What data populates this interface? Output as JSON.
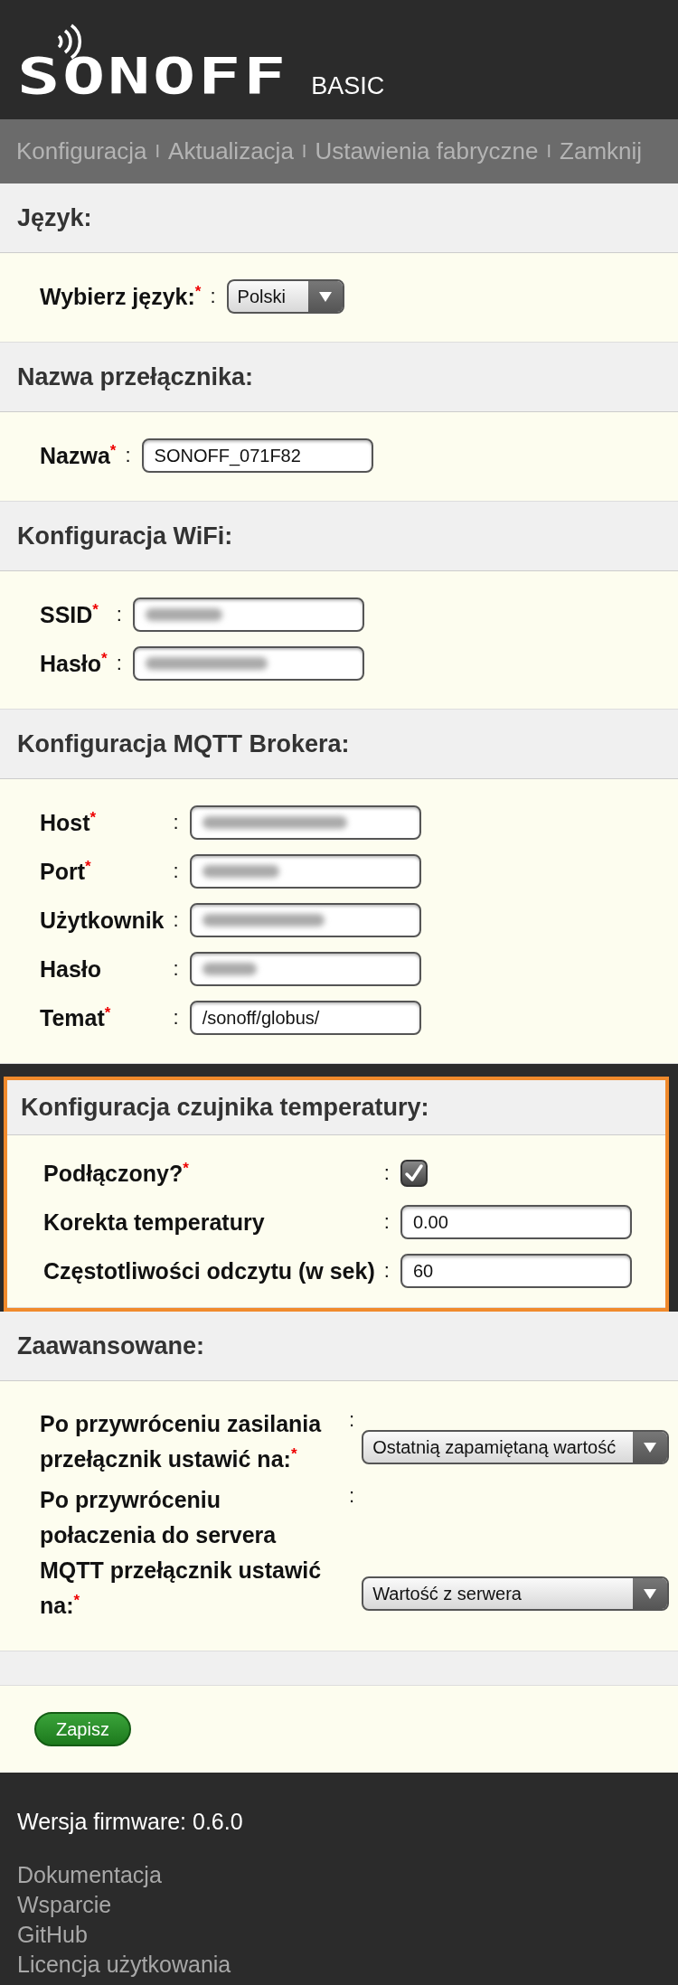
{
  "header": {
    "logo": "SONOFF",
    "model": "BASIC"
  },
  "nav": [
    {
      "label": "Konfiguracja",
      "separator": "I"
    },
    {
      "label": "Aktualizacja",
      "separator": "I"
    },
    {
      "label": "Ustawienia fabryczne",
      "separator": "I"
    },
    {
      "label": "Zamknij"
    }
  ],
  "sections": [
    {
      "title": "Język:",
      "highlighted": false,
      "label_wrap": false,
      "fields": [
        {
          "kind": "select",
          "label": "Wybierz język:$^{*}$",
          "colon": ":",
          "value": "Polski"
        }
      ]
    },
    {
      "title": "Nazwa przełącznika:",
      "highlighted": false,
      "label_wrap": false,
      "fields": [
        {
          "kind": "text",
          "label": "Nazwa$^{*}$",
          "colon": ":",
          "value": "SONOFF_071F82"
        }
      ]
    },
    {
      "title": "Konfiguracja WiFi:",
      "highlighted": false,
      "label_wrap": false,
      "fields": [
        {
          "kind": "text",
          "label": "SSID$^{*}$",
          "colon": ":",
          "blurred": true
        },
        {
          "kind": "text",
          "label": "Hasło$^{*}$",
          "colon": ":",
          "blurred": true
        }
      ]
    },
    {
      "title": "Konfiguracja MQTT Brokera:",
      "highlighted": false,
      "label_wrap": false,
      "fields": [
        {
          "kind": "text",
          "label": "Host$^{*}$",
          "colon": ":",
          "blurred": true
        },
        {
          "kind": "text",
          "label": "Port$^{*}$",
          "colon": ":",
          "blurred": true
        },
        {
          "kind": "text",
          "label": "Użytkownik",
          "colon": ":",
          "blurred": true
        },
        {
          "kind": "text",
          "label": "Hasło",
          "colon": ":",
          "blurred": true
        },
        {
          "kind": "text",
          "label": "Temat$^{*}$",
          "colon": ":",
          "value": "/sonoff/globus/"
        }
      ]
    },
    {
      "title": "Konfiguracja czujnika temperatury:",
      "highlighted": true,
      "label_wrap": false,
      "fields": [
        {
          "kind": "checkbox",
          "label": "Podłączony?$^{*}$",
          "colon": ":",
          "checked": true
        },
        {
          "kind": "text",
          "label": "Korekta temperatury",
          "colon": ":",
          "value": "0.00"
        },
        {
          "kind": "text",
          "label": "Częstotliwości odczytu (w sek)",
          "colon": ":",
          "value": "60"
        }
      ]
    },
    {
      "title": "Zaawansowane:",
      "highlighted": false,
      "label_wrap": true,
      "fields": [
        {
          "kind": "select",
          "label": "Po przywróceniu zasilania przełącznik ustawić na:$^{*}$",
          "colon": ":",
          "value": "Ostatnią zapamiętaną wartość"
        },
        {
          "kind": "select",
          "label": "Po przywróceniu połaczenia do servera MQTT przełącznik ustawić na:$^{*}$",
          "colon": ":",
          "value": "Wartość z serwera"
        }
      ]
    }
  ],
  "save_button": "Zapisz",
  "footer": {
    "version": "Wersja firmware: 0.6.0",
    "links": [
      "Dokumentacja",
      "Wsparcie",
      "GitHub",
      "Licencja użytkowania"
    ]
  }
}
